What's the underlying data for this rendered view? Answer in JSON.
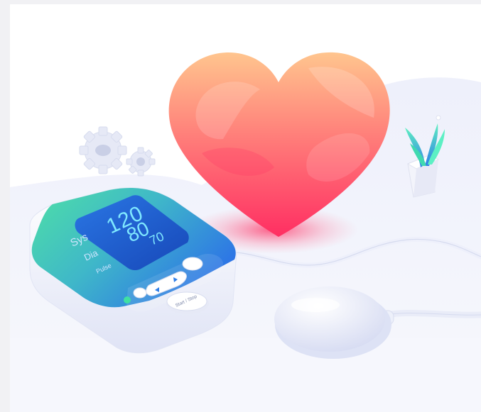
{
  "monitor": {
    "screen": {
      "systolic": "120",
      "diastolic": "80",
      "pulse": "70",
      "sys_label": "Sys",
      "dia_label": "Dia",
      "pulse_label": "Pulse"
    },
    "start_stop_label": "Start / Stop"
  },
  "colors": {
    "heart_top": "#ffb98a",
    "heart_bottom": "#ff2f63",
    "screen": "#1f5fd6",
    "monitor_top_left": "#43d7a4",
    "monitor_top_right": "#2f7ee8",
    "readout": "#7fe8ff",
    "backdrop": "#eceef9"
  }
}
